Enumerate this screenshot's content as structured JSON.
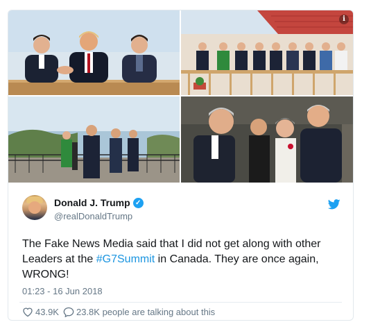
{
  "tweet": {
    "display_name": "Donald J. Trump",
    "handle": "@realDonaldTrump",
    "text_before": "The Fake News Media said that I did not get along with other Leaders at the ",
    "hashtag": "#G7Summit",
    "text_after": " in Canada. They are once again, WRONG!",
    "timestamp": "01:23 - 16 Jun 2018",
    "likes": "43.9K",
    "talking": "23.8K people are talking about this",
    "verified": true
  },
  "icons": {
    "info": "info-icon",
    "verified": "verified-badge-icon",
    "brand": "twitter-bird-icon",
    "like": "heart-icon",
    "reply": "speech-bubble-icon"
  },
  "colors": {
    "accent": "#1da1f2",
    "hashtag": "#1b95e0",
    "muted": "#657786",
    "text": "#14171a"
  },
  "media": {
    "info_glyph": "i"
  }
}
